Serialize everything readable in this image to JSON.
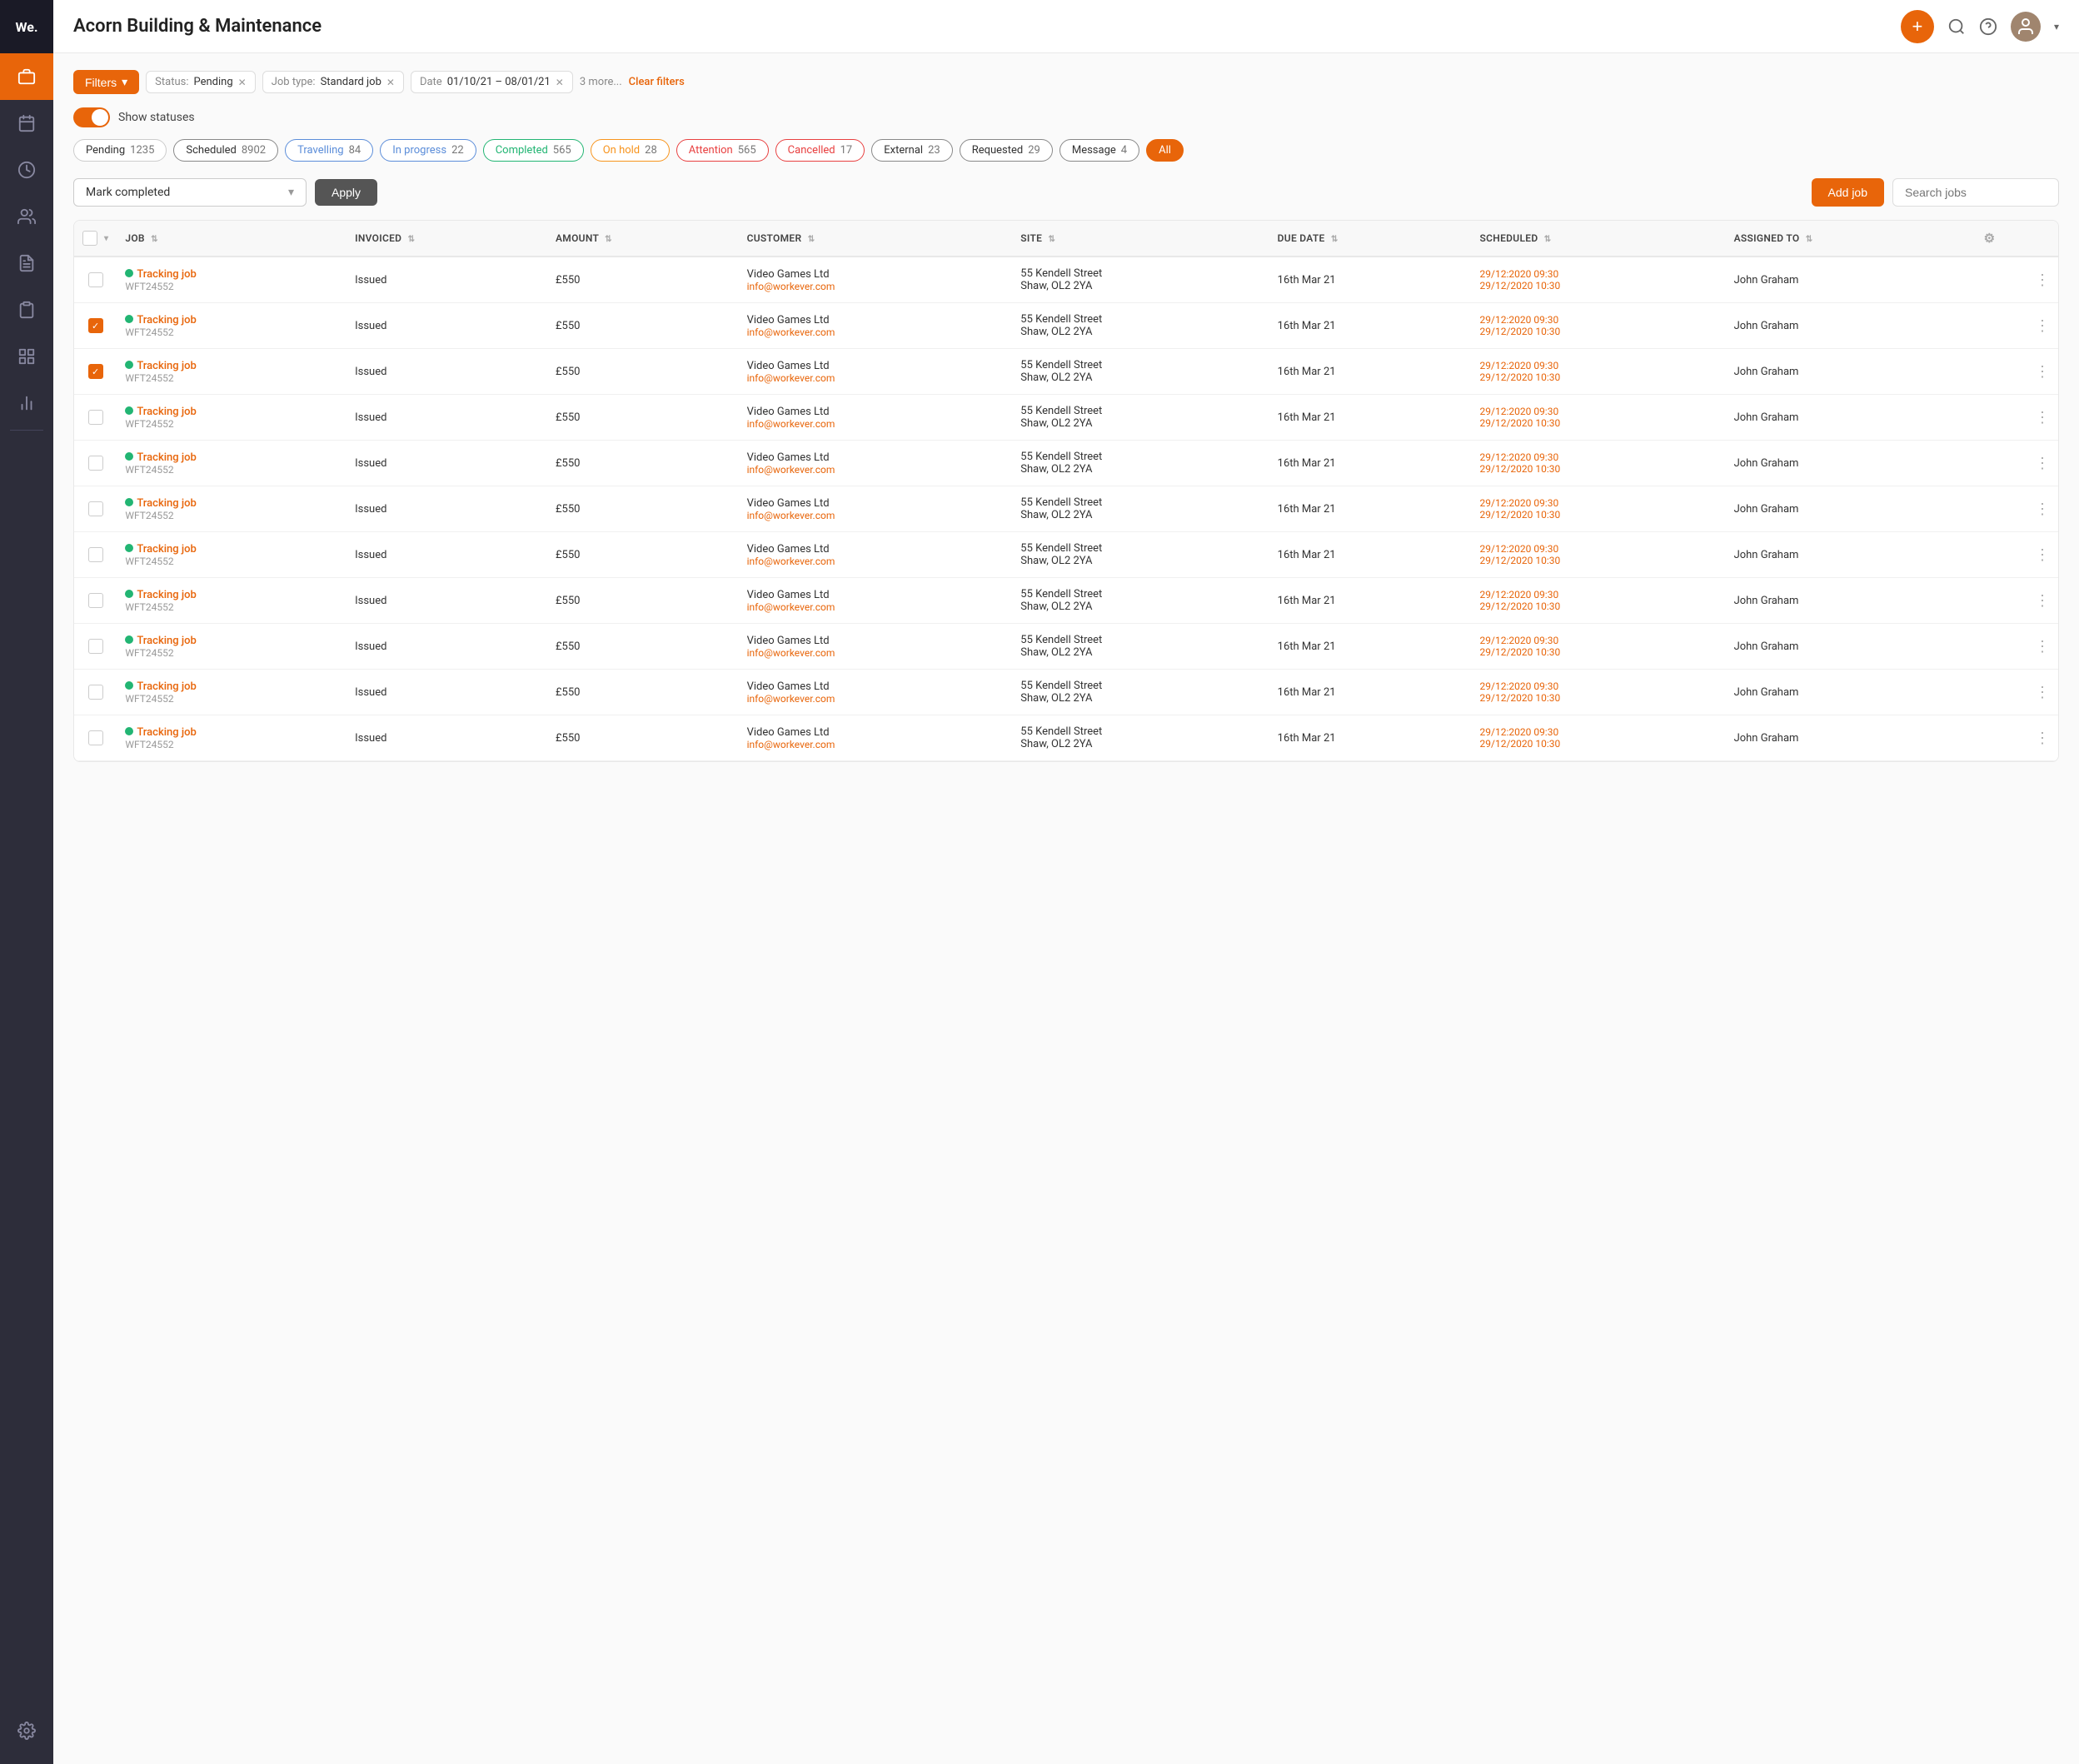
{
  "app": {
    "logo": "We.",
    "title": "Acorn Building & Maintenance"
  },
  "sidebar": {
    "items": [
      {
        "id": "briefcase",
        "label": "Jobs",
        "active": true
      },
      {
        "id": "calendar",
        "label": "Calendar",
        "active": false
      },
      {
        "id": "clock",
        "label": "History",
        "active": false
      },
      {
        "id": "users",
        "label": "Users",
        "active": false
      },
      {
        "id": "file",
        "label": "Reports",
        "active": false
      },
      {
        "id": "clipboard",
        "label": "Notes",
        "active": false
      },
      {
        "id": "grid",
        "label": "Dashboard",
        "active": false
      },
      {
        "id": "bar-chart",
        "label": "Analytics",
        "active": false
      }
    ]
  },
  "header": {
    "title": "Acorn Building & Maintenance",
    "add_button_label": "+",
    "search_tooltip": "Search",
    "help_tooltip": "Help"
  },
  "filters": {
    "button_label": "Filters",
    "active_filters": [
      {
        "label": "Status:",
        "value": "Pending",
        "id": "status-filter"
      },
      {
        "label": "Job type:",
        "value": "Standard job",
        "id": "job-type-filter"
      },
      {
        "label": "Date",
        "value": "01/10/21 – 08/01/21",
        "id": "date-filter"
      }
    ],
    "more_label": "3 more...",
    "clear_label": "Clear filters"
  },
  "toggle": {
    "label": "Show statuses",
    "checked": true
  },
  "status_badges": [
    {
      "id": "pending",
      "label": "Pending",
      "count": "1235",
      "color_class": "pending"
    },
    {
      "id": "scheduled",
      "label": "Scheduled",
      "count": "8902",
      "color_class": "scheduled"
    },
    {
      "id": "travelling",
      "label": "Travelling",
      "count": "84",
      "color_class": "travelling"
    },
    {
      "id": "in-progress",
      "label": "In progress",
      "count": "22",
      "color_class": "in-progress"
    },
    {
      "id": "completed",
      "label": "Completed",
      "count": "565",
      "color_class": "completed"
    },
    {
      "id": "on-hold",
      "label": "On hold",
      "count": "28",
      "color_class": "on-hold"
    },
    {
      "id": "attention",
      "label": "Attention",
      "count": "565",
      "color_class": "attention"
    },
    {
      "id": "cancelled",
      "label": "Cancelled",
      "count": "17",
      "color_class": "cancelled"
    },
    {
      "id": "external",
      "label": "External",
      "count": "23",
      "color_class": "external"
    },
    {
      "id": "requested",
      "label": "Requested",
      "count": "29",
      "color_class": "requested"
    },
    {
      "id": "message",
      "label": "Message",
      "count": "4",
      "color_class": "message"
    },
    {
      "id": "all",
      "label": "All",
      "count": "",
      "color_class": "all-btn"
    }
  ],
  "action_bar": {
    "dropdown_label": "Mark completed",
    "apply_label": "Apply",
    "add_job_label": "Add job",
    "search_placeholder": "Search jobs"
  },
  "table": {
    "columns": [
      {
        "id": "checkbox",
        "label": ""
      },
      {
        "id": "job",
        "label": "JOB"
      },
      {
        "id": "invoiced",
        "label": "INVOICED"
      },
      {
        "id": "amount",
        "label": "AMOUNT"
      },
      {
        "id": "customer",
        "label": "CUSTOMER"
      },
      {
        "id": "site",
        "label": "SITE"
      },
      {
        "id": "due_date",
        "label": "DUE DATE"
      },
      {
        "id": "scheduled",
        "label": "SCHEDULED"
      },
      {
        "id": "assigned_to",
        "label": "ASSIGNED TO"
      },
      {
        "id": "actions",
        "label": ""
      }
    ],
    "rows": [
      {
        "checked": false,
        "job_name": "Tracking job",
        "job_code": "WFT24552",
        "invoiced": "Issued",
        "amount": "£550",
        "customer_name": "Video Games Ltd",
        "customer_email": "info@workever.com",
        "site": "55 Kendell Street",
        "site_city": "Shaw, OL2 2YA",
        "due_date": "16th Mar 21",
        "scheduled_start": "29/12:2020 09:30",
        "scheduled_end": "29/12/2020 10:30",
        "assigned_to": "John Graham"
      },
      {
        "checked": true,
        "job_name": "Tracking job",
        "job_code": "WFT24552",
        "invoiced": "Issued",
        "amount": "£550",
        "customer_name": "Video Games Ltd",
        "customer_email": "info@workever.com",
        "site": "55 Kendell Street",
        "site_city": "Shaw, OL2 2YA",
        "due_date": "16th Mar 21",
        "scheduled_start": "29/12:2020 09:30",
        "scheduled_end": "29/12/2020 10:30",
        "assigned_to": "John Graham"
      },
      {
        "checked": true,
        "job_name": "Tracking job",
        "job_code": "WFT24552",
        "invoiced": "Issued",
        "amount": "£550",
        "customer_name": "Video Games Ltd",
        "customer_email": "info@workever.com",
        "site": "55 Kendell Street",
        "site_city": "Shaw, OL2 2YA",
        "due_date": "16th Mar 21",
        "scheduled_start": "29/12:2020 09:30",
        "scheduled_end": "29/12/2020 10:30",
        "assigned_to": "John Graham"
      },
      {
        "checked": false,
        "job_name": "Tracking job",
        "job_code": "WFT24552",
        "invoiced": "Issued",
        "amount": "£550",
        "customer_name": "Video Games Ltd",
        "customer_email": "info@workever.com",
        "site": "55 Kendell Street",
        "site_city": "Shaw, OL2 2YA",
        "due_date": "16th Mar 21",
        "scheduled_start": "29/12:2020 09:30",
        "scheduled_end": "29/12/2020 10:30",
        "assigned_to": "John Graham"
      },
      {
        "checked": false,
        "job_name": "Tracking job",
        "job_code": "WFT24552",
        "invoiced": "Issued",
        "amount": "£550",
        "customer_name": "Video Games Ltd",
        "customer_email": "info@workever.com",
        "site": "55 Kendell Street",
        "site_city": "Shaw, OL2 2YA",
        "due_date": "16th Mar 21",
        "scheduled_start": "29/12:2020 09:30",
        "scheduled_end": "29/12/2020 10:30",
        "assigned_to": "John Graham"
      },
      {
        "checked": false,
        "job_name": "Tracking job",
        "job_code": "WFT24552",
        "invoiced": "Issued",
        "amount": "£550",
        "customer_name": "Video Games Ltd",
        "customer_email": "info@workever.com",
        "site": "55 Kendell Street",
        "site_city": "Shaw, OL2 2YA",
        "due_date": "16th Mar 21",
        "scheduled_start": "29/12:2020 09:30",
        "scheduled_end": "29/12/2020 10:30",
        "assigned_to": "John Graham"
      },
      {
        "checked": false,
        "job_name": "Tracking job",
        "job_code": "WFT24552",
        "invoiced": "Issued",
        "amount": "£550",
        "customer_name": "Video Games Ltd",
        "customer_email": "info@workever.com",
        "site": "55 Kendell Street",
        "site_city": "Shaw, OL2 2YA",
        "due_date": "16th Mar 21",
        "scheduled_start": "29/12:2020 09:30",
        "scheduled_end": "29/12/2020 10:30",
        "assigned_to": "John Graham"
      },
      {
        "checked": false,
        "job_name": "Tracking job",
        "job_code": "WFT24552",
        "invoiced": "Issued",
        "amount": "£550",
        "customer_name": "Video Games Ltd",
        "customer_email": "info@workever.com",
        "site": "55 Kendell Street",
        "site_city": "Shaw, OL2 2YA",
        "due_date": "16th Mar 21",
        "scheduled_start": "29/12:2020 09:30",
        "scheduled_end": "29/12/2020 10:30",
        "assigned_to": "John Graham"
      },
      {
        "checked": false,
        "job_name": "Tracking job",
        "job_code": "WFT24552",
        "invoiced": "Issued",
        "amount": "£550",
        "customer_name": "Video Games Ltd",
        "customer_email": "info@workever.com",
        "site": "55 Kendell Street",
        "site_city": "Shaw, OL2 2YA",
        "due_date": "16th Mar 21",
        "scheduled_start": "29/12:2020 09:30",
        "scheduled_end": "29/12/2020 10:30",
        "assigned_to": "John Graham"
      },
      {
        "checked": false,
        "job_name": "Tracking job",
        "job_code": "WFT24552",
        "invoiced": "Issued",
        "amount": "£550",
        "customer_name": "Video Games Ltd",
        "customer_email": "info@workever.com",
        "site": "55 Kendell Street",
        "site_city": "Shaw, OL2 2YA",
        "due_date": "16th Mar 21",
        "scheduled_start": "29/12:2020 09:30",
        "scheduled_end": "29/12/2020 10:30",
        "assigned_to": "John Graham"
      },
      {
        "checked": false,
        "job_name": "Tracking job",
        "job_code": "WFT24552",
        "invoiced": "Issued",
        "amount": "£550",
        "customer_name": "Video Games Ltd",
        "customer_email": "info@workever.com",
        "site": "55 Kendell Street",
        "site_city": "Shaw, OL2 2YA",
        "due_date": "16th Mar 21",
        "scheduled_start": "29/12:2020 09:30",
        "scheduled_end": "29/12/2020 10:30",
        "assigned_to": "John Graham"
      }
    ]
  }
}
